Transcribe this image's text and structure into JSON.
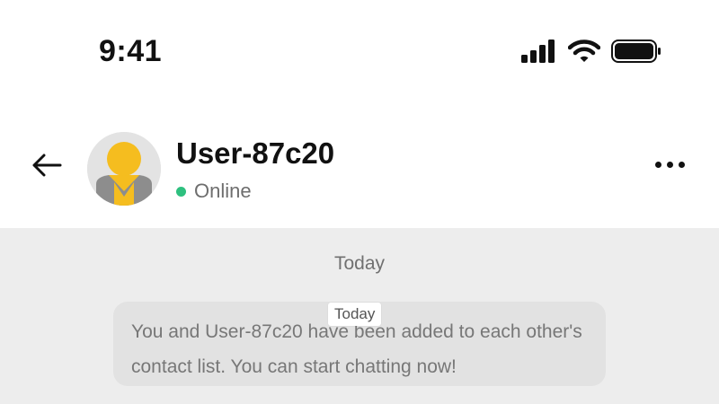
{
  "status_bar": {
    "time": "9:41",
    "icons": [
      "cellular-signal-icon",
      "wifi-icon",
      "battery-icon"
    ]
  },
  "header": {
    "back_icon": "arrow-left-icon",
    "contact": {
      "name": "User-87c20",
      "status": "Online",
      "status_color": "#2ec07f"
    },
    "more_icon": "more-horizontal-icon"
  },
  "chat": {
    "date_label": "Today",
    "system_message": "You and User-87c20 have been added to each other's contact list. You can start chatting now!",
    "tooltip": "Today"
  },
  "colors": {
    "avatar_yellow": "#f5bd1f",
    "avatar_bg": "#e3e3e3",
    "avatar_shirt": "#8d8d8d",
    "chat_bg": "#ededed",
    "bubble_bg": "#e2e2e2",
    "online": "#2ec07f"
  }
}
